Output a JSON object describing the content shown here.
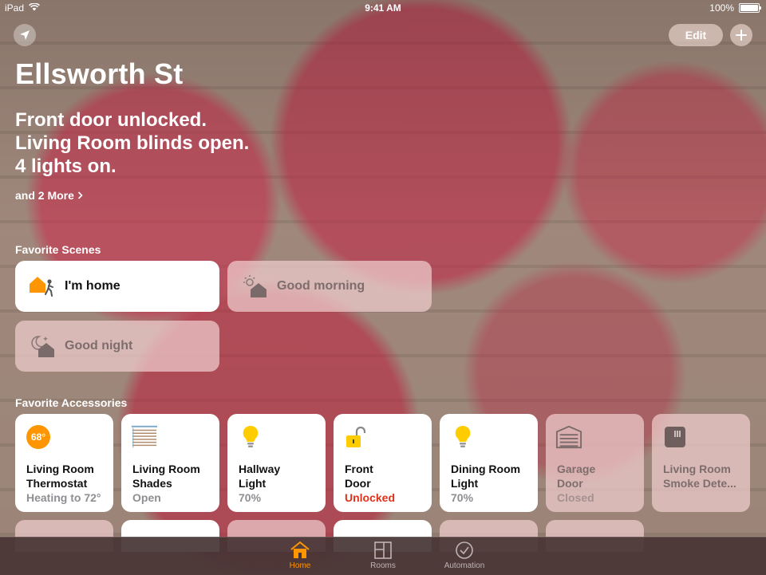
{
  "status_bar": {
    "carrier": "iPad",
    "time": "9:41 AM",
    "battery": "100%"
  },
  "top_bar": {
    "edit_label": "Edit"
  },
  "home": {
    "title": "Ellsworth St",
    "summary": [
      "Front door unlocked.",
      "Living Room blinds open.",
      "4 lights on."
    ],
    "more_label": "and 2 More"
  },
  "favorite_scenes": {
    "title": "Favorite Scenes",
    "items": [
      {
        "label": "I'm home",
        "icon": "home-arrive-icon",
        "active": true
      },
      {
        "label": "Good morning",
        "icon": "sunrise-home-icon",
        "active": false
      },
      {
        "label": "Good night",
        "icon": "moon-home-icon",
        "active": false
      }
    ]
  },
  "favorite_accessories": {
    "title": "Favorite Accessories",
    "items": [
      {
        "name": [
          "Living Room",
          "Thermostat"
        ],
        "status": "Heating to 72°",
        "icon": "thermostat-icon",
        "badge": "68°",
        "active": true
      },
      {
        "name": [
          "Living Room",
          "Shades"
        ],
        "status": "Open",
        "icon": "shades-icon",
        "active": true
      },
      {
        "name": [
          "Hallway",
          "Light"
        ],
        "status": "70%",
        "icon": "lightbulb-icon",
        "active": true
      },
      {
        "name": [
          "Front",
          "Door"
        ],
        "status": "Unlocked",
        "icon": "unlocked-icon",
        "active": true,
        "alert": true
      },
      {
        "name": [
          "Dining Room",
          "Light"
        ],
        "status": "70%",
        "icon": "lightbulb-icon",
        "active": true
      },
      {
        "name": [
          "Garage",
          "Door"
        ],
        "status": "Closed",
        "icon": "garage-door-icon",
        "active": false
      },
      {
        "name": [
          "Living Room",
          "Smoke Dete..."
        ],
        "status": "",
        "icon": "smoke-detector-icon",
        "active": false
      }
    ]
  },
  "tab_bar": {
    "tabs": [
      {
        "label": "Home",
        "icon": "home-tab-icon",
        "active": true
      },
      {
        "label": "Rooms",
        "icon": "rooms-tab-icon",
        "active": false
      },
      {
        "label": "Automation",
        "icon": "automation-tab-icon",
        "active": false
      }
    ]
  },
  "colors": {
    "accent": "#ff9500",
    "alert": "#e0321b"
  }
}
